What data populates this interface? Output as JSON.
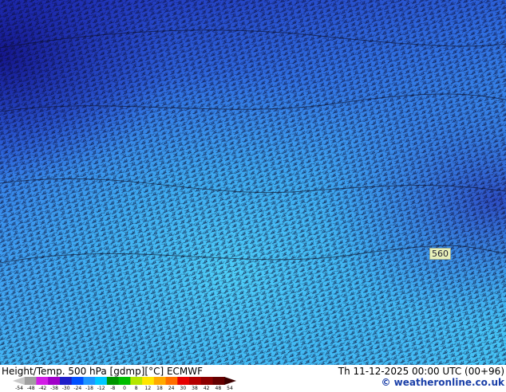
{
  "map": {
    "contour_label": "560"
  },
  "footer": {
    "title": "Height/Temp. 500 hPa [gdmp][°C] ECMWF",
    "datetime": "Th 11-12-2025 00:00 UTC (00+96)",
    "credit": "© weatheronline.co.uk"
  },
  "legend": {
    "ticks": [
      "-54",
      "-48",
      "-42",
      "-38",
      "-30",
      "-24",
      "-18",
      "-12",
      "-8",
      "0",
      "8",
      "12",
      "18",
      "24",
      "30",
      "38",
      "42",
      "48",
      "54"
    ],
    "colors": [
      "#c8c8c8",
      "#a0a0a0",
      "#d21ee6",
      "#a000c8",
      "#1e1ec8",
      "#0050ff",
      "#1e96ff",
      "#00c8ff",
      "#009600",
      "#00be00",
      "#b4e600",
      "#ffe600",
      "#ffaa00",
      "#ff6e00",
      "#e60000",
      "#b40000",
      "#8c0000",
      "#640000",
      "#3c0000"
    ]
  }
}
